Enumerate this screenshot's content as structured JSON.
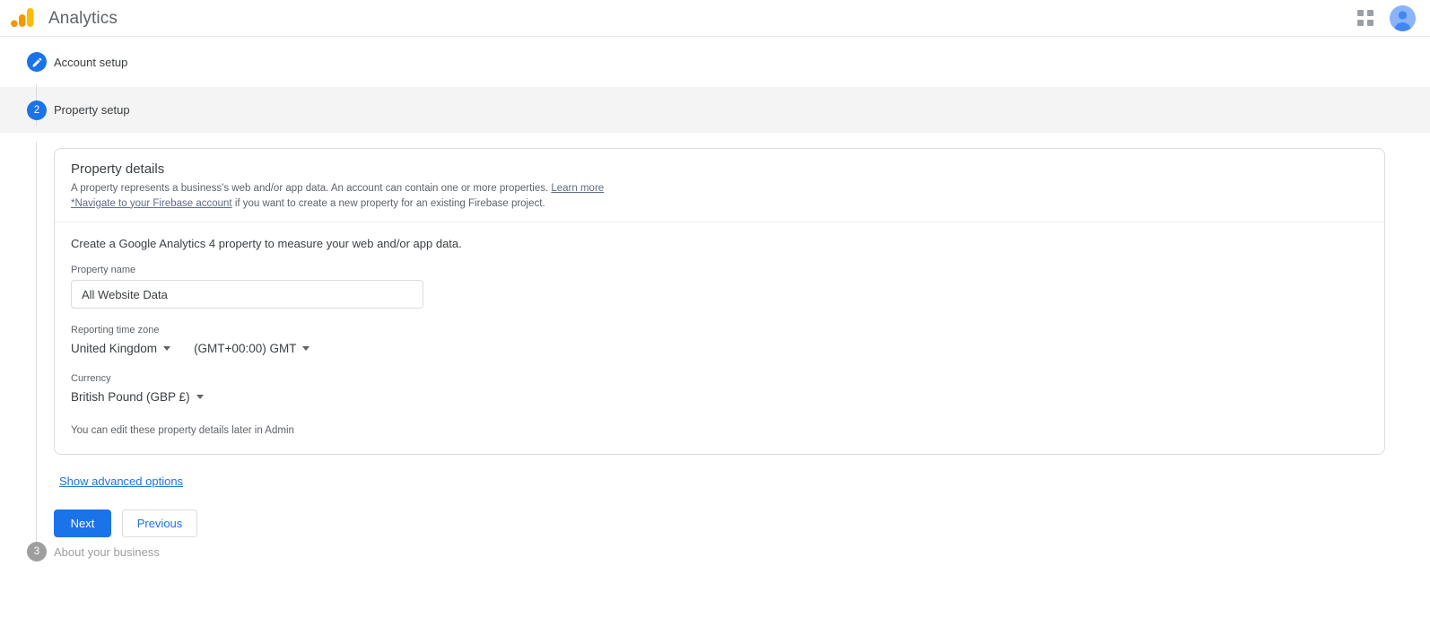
{
  "header": {
    "brand_title": "Analytics",
    "logo_icon": "google-analytics-logo",
    "apps_icon": "apps-grid-icon",
    "avatar_icon": "user-avatar-icon"
  },
  "stepper": {
    "steps": [
      {
        "marker": "✎",
        "label": "Account setup",
        "state": "done"
      },
      {
        "marker": "2",
        "label": "Property setup",
        "state": "current"
      },
      {
        "marker": "3",
        "label": "About your business",
        "state": "todo"
      }
    ]
  },
  "card": {
    "title": "Property details",
    "desc_line1_a": "A property represents a business's web and/or app data. An account can contain one or more properties. ",
    "desc_learn_more": "Learn more",
    "desc_line2_link": "*Navigate to your Firebase account",
    "desc_line2_rest": " if you want to create a new property for an existing Firebase project.",
    "lead": "Create a Google Analytics 4 property to measure your web and/or app data.",
    "property_name_label": "Property name",
    "property_name_value": "All Website Data",
    "property_name_placeholder": "Property name",
    "timezone_label": "Reporting time zone",
    "timezone_country": "United Kingdom",
    "timezone_offset": "(GMT+00:00) GMT",
    "currency_label": "Currency",
    "currency_value": "British Pound (GBP £)",
    "note": "You can edit these property details later in Admin"
  },
  "actions": {
    "advanced_options": "Show advanced options",
    "next": "Next",
    "previous": "Previous"
  },
  "colors": {
    "accent_blue": "#1a73e8",
    "logo_orange": "#f29900",
    "logo_amber": "#fbbc04",
    "avatar_blue": "#8ab4f8",
    "muted_gray": "#9e9e9e"
  }
}
